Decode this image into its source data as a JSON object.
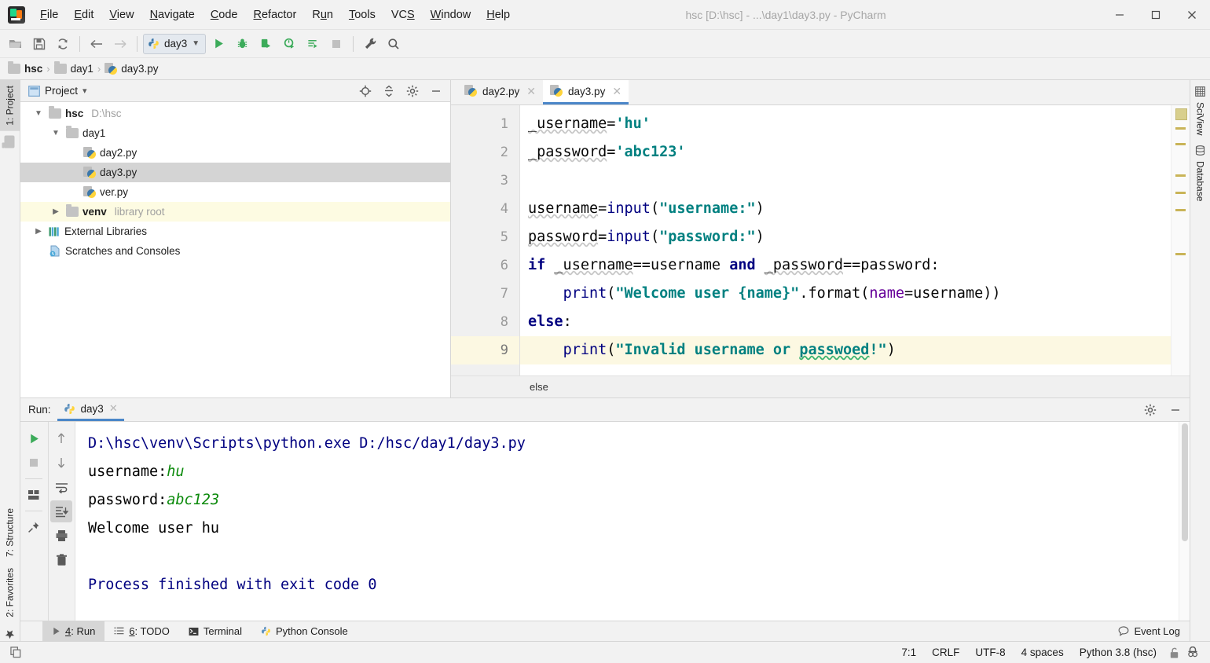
{
  "window": {
    "title": "hsc [D:\\hsc] - ...\\day1\\day3.py - PyCharm",
    "minimize": "—",
    "maximize": "☐",
    "close": "✕"
  },
  "menu": {
    "items": [
      {
        "label": "File",
        "mnemonic": "F"
      },
      {
        "label": "Edit",
        "mnemonic": "E"
      },
      {
        "label": "View",
        "mnemonic": "V"
      },
      {
        "label": "Navigate",
        "mnemonic": "N"
      },
      {
        "label": "Code",
        "mnemonic": "C"
      },
      {
        "label": "Refactor",
        "mnemonic": "R"
      },
      {
        "label": "Run",
        "mnemonic": "u"
      },
      {
        "label": "Tools",
        "mnemonic": "T"
      },
      {
        "label": "VCS",
        "mnemonic": "S"
      },
      {
        "label": "Window",
        "mnemonic": "W"
      },
      {
        "label": "Help",
        "mnemonic": "H"
      }
    ]
  },
  "toolbar": {
    "icons": [
      "open-folder-icon",
      "save-icon",
      "sync-icon",
      "back-arrow-icon",
      "forward-arrow-icon"
    ],
    "run_config": "day3",
    "run_icons": [
      "run-icon",
      "debug-icon",
      "run-coverage-icon",
      "profile-icon",
      "run-tests-icon",
      "stop-icon"
    ],
    "right_icons": [
      "settings-wrench-icon",
      "search-icon"
    ]
  },
  "breadcrumb": {
    "items": [
      {
        "label": "hsc",
        "icon": "folder-icon",
        "bold": true
      },
      {
        "label": "day1",
        "icon": "folder-icon",
        "bold": false
      },
      {
        "label": "day3.py",
        "icon": "python-file-icon",
        "bold": false
      }
    ],
    "separator": "›"
  },
  "left_stripe": {
    "top": [
      {
        "label": "1: Project",
        "active": true
      }
    ],
    "bottom": [
      {
        "label": "7: Structure",
        "active": false
      },
      {
        "label": "2: Favorites",
        "active": false
      }
    ]
  },
  "right_stripe": {
    "items": [
      {
        "label": "SciView"
      },
      {
        "label": "Database"
      }
    ]
  },
  "project_panel": {
    "title": "Project",
    "dropdown": "▾",
    "header_icons": [
      "locate-target-icon",
      "collapse-all-icon",
      "gear-icon",
      "hide-icon"
    ],
    "tree": [
      {
        "label": "hsc",
        "sub": "D:\\hsc",
        "icon": "folder-icon",
        "indent": 0,
        "twisty": "expanded",
        "bold": true,
        "state": ""
      },
      {
        "label": "day1",
        "sub": "",
        "icon": "folder-icon",
        "indent": 1,
        "twisty": "expanded",
        "bold": false,
        "state": ""
      },
      {
        "label": "day2.py",
        "sub": "",
        "icon": "python-file-icon",
        "indent": 2,
        "twisty": "",
        "bold": false,
        "state": ""
      },
      {
        "label": "day3.py",
        "sub": "",
        "icon": "python-file-icon",
        "indent": 2,
        "twisty": "",
        "bold": false,
        "state": "selected"
      },
      {
        "label": "ver.py",
        "sub": "",
        "icon": "python-file-icon",
        "indent": 2,
        "twisty": "",
        "bold": false,
        "state": ""
      },
      {
        "label": "venv",
        "sub": "library root",
        "icon": "folder-icon",
        "indent": 1,
        "twisty": "collapsed",
        "bold": true,
        "state": "highlight"
      },
      {
        "label": "External Libraries",
        "sub": "",
        "icon": "libraries-icon",
        "indent": 0,
        "twisty": "collapsed",
        "bold": false,
        "state": ""
      },
      {
        "label": "Scratches and Consoles",
        "sub": "",
        "icon": "scratches-icon",
        "indent": 0,
        "twisty": "",
        "bold": false,
        "state": ""
      }
    ]
  },
  "editor": {
    "tabs": [
      {
        "label": "day2.py",
        "icon": "python-file-icon",
        "active": false,
        "close": "✕"
      },
      {
        "label": "day3.py",
        "icon": "python-file-icon",
        "active": true,
        "close": "✕"
      }
    ],
    "line_numbers": [
      "1",
      "2",
      "3",
      "4",
      "5",
      "6",
      "7",
      "8",
      "9"
    ],
    "current_line": 9,
    "lines": [
      "_username='hu'",
      "_password='abc123'",
      "",
      "username=input(\"username:\")",
      "password=input(\"password:\")",
      "if _username==username and _password==password:",
      "    print(\"Welcome user {name}\".format(name=username))",
      "else:",
      "    print(\"Invalid username or passwoed!\")"
    ],
    "breadcrumb_bottom": "else"
  },
  "run_panel": {
    "label": "Run:",
    "tab": "day3",
    "tab_icon": "python-icon",
    "tab_close": "✕",
    "header_icons": [
      "gear-icon",
      "hide-icon"
    ],
    "left_tools": [
      "rerun-icon",
      "stop-icon",
      "layout-icon",
      "pin-icon"
    ],
    "right_tools": [
      "up-arrow-icon",
      "down-arrow-icon",
      "soft-wrap-icon",
      "scroll-to-end-icon",
      "print-icon",
      "trash-icon"
    ],
    "active_tool": "scroll-to-end-icon",
    "console": [
      {
        "text": "D:\\hsc\\venv\\Scripts\\python.exe D:/hsc/day1/day3.py",
        "kind": "blue"
      },
      {
        "prompt": "username:",
        "input": "hu",
        "kind": "prompt"
      },
      {
        "prompt": "password:",
        "input": "abc123",
        "kind": "prompt"
      },
      {
        "text": "Welcome user hu",
        "kind": "plain"
      },
      {
        "text": "",
        "kind": "plain"
      },
      {
        "text": "Process finished with exit code 0",
        "kind": "blue"
      }
    ]
  },
  "tool_window_bar": {
    "tabs": [
      {
        "label": "4: Run",
        "icon": "run-icon",
        "active": true
      },
      {
        "label": "6: TODO",
        "icon": "todo-icon",
        "active": false
      },
      {
        "label": "Terminal",
        "icon": "terminal-icon",
        "active": false
      },
      {
        "label": "Python Console",
        "icon": "python-icon",
        "active": false
      }
    ],
    "event_log": "Event Log",
    "event_log_icon": "balloon-icon"
  },
  "status_bar": {
    "caret": "7:1",
    "line_separator": "CRLF",
    "encoding": "UTF-8",
    "indent": "4 spaces",
    "interpreter": "Python 3.8 (hsc)",
    "icons": [
      "lock-icon",
      "inspector-icon"
    ],
    "left_icon": "copy-icon"
  },
  "colors": {
    "accent": "#4a86c8",
    "keyword": "#000080",
    "string": "#008080",
    "kwarg": "#660099",
    "console_blue": "#000080",
    "console_input": "#0b8a0b",
    "selection": "#d4d4d4",
    "current_line": "#fcf8e2"
  }
}
